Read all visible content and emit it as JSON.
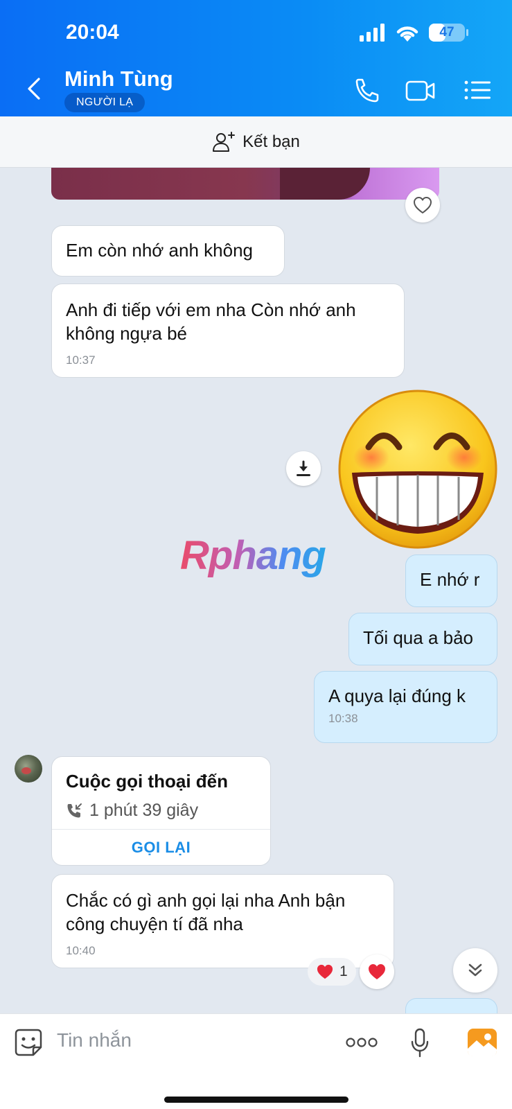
{
  "status_bar": {
    "time": "20:04",
    "battery": "47",
    "battery_level_percent": 47
  },
  "header": {
    "name": "Minh Tùng",
    "badge": "NGƯỜI LẠ"
  },
  "friend_bar": {
    "label": "Kết bạn"
  },
  "messages": [
    {
      "direction": "in",
      "text": "Em còn nhớ anh không"
    },
    {
      "direction": "in",
      "text": "Anh đi tiếp với em nha Còn nhớ anh không ngựa bé",
      "time": "10:37"
    },
    {
      "direction": "out",
      "type": "sticker",
      "sticker": "grinning-face-sticker"
    },
    {
      "direction": "out",
      "text": "E nhớ r"
    },
    {
      "direction": "out",
      "text": "Tối qua a bảo"
    },
    {
      "direction": "out",
      "text": "A quya lại đúng k",
      "time": "10:38"
    },
    {
      "direction": "in",
      "text": "Chắc có gì anh gọi lại nha Anh bận công chuyện tí đã nha",
      "time": "10:40"
    }
  ],
  "call_card": {
    "title": "Cuộc gọi thoại đến",
    "duration": "1 phút 39 giây",
    "action": "GỌI LẠI"
  },
  "reaction": {
    "icon": "heart",
    "count": "1"
  },
  "watermark": "Rphang",
  "composer": {
    "placeholder": "Tin nhắn"
  },
  "colors": {
    "header": "#0a8cf5",
    "outgoing_bubble": "#d5eefe",
    "background": "#e2e8f0",
    "accent": "#1a8de6",
    "heart": "#e8283a"
  }
}
